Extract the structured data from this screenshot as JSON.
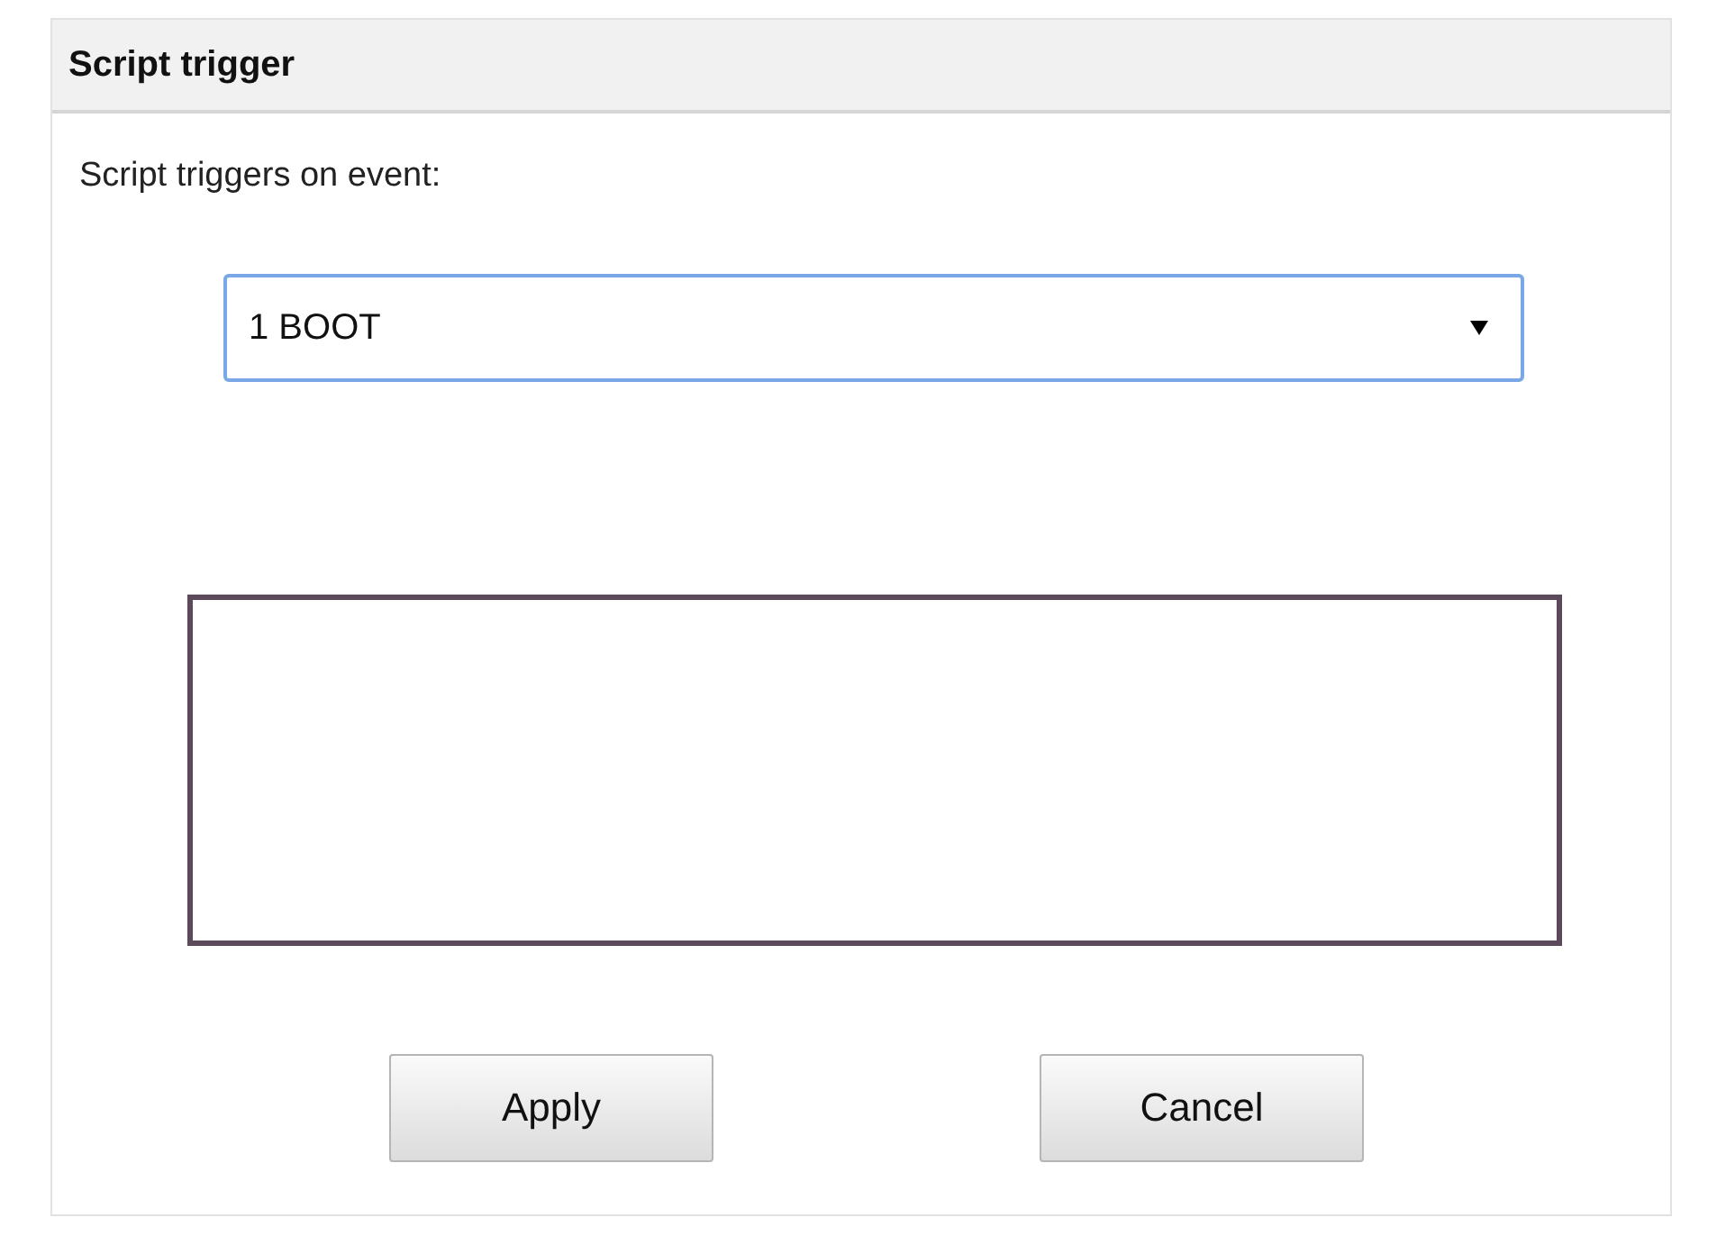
{
  "panel": {
    "title": "Script trigger"
  },
  "label": "Script triggers on event:",
  "event_select": {
    "value": "1 BOOT",
    "focused": true
  },
  "buttons": [
    "Apply",
    "Cancel"
  ]
}
